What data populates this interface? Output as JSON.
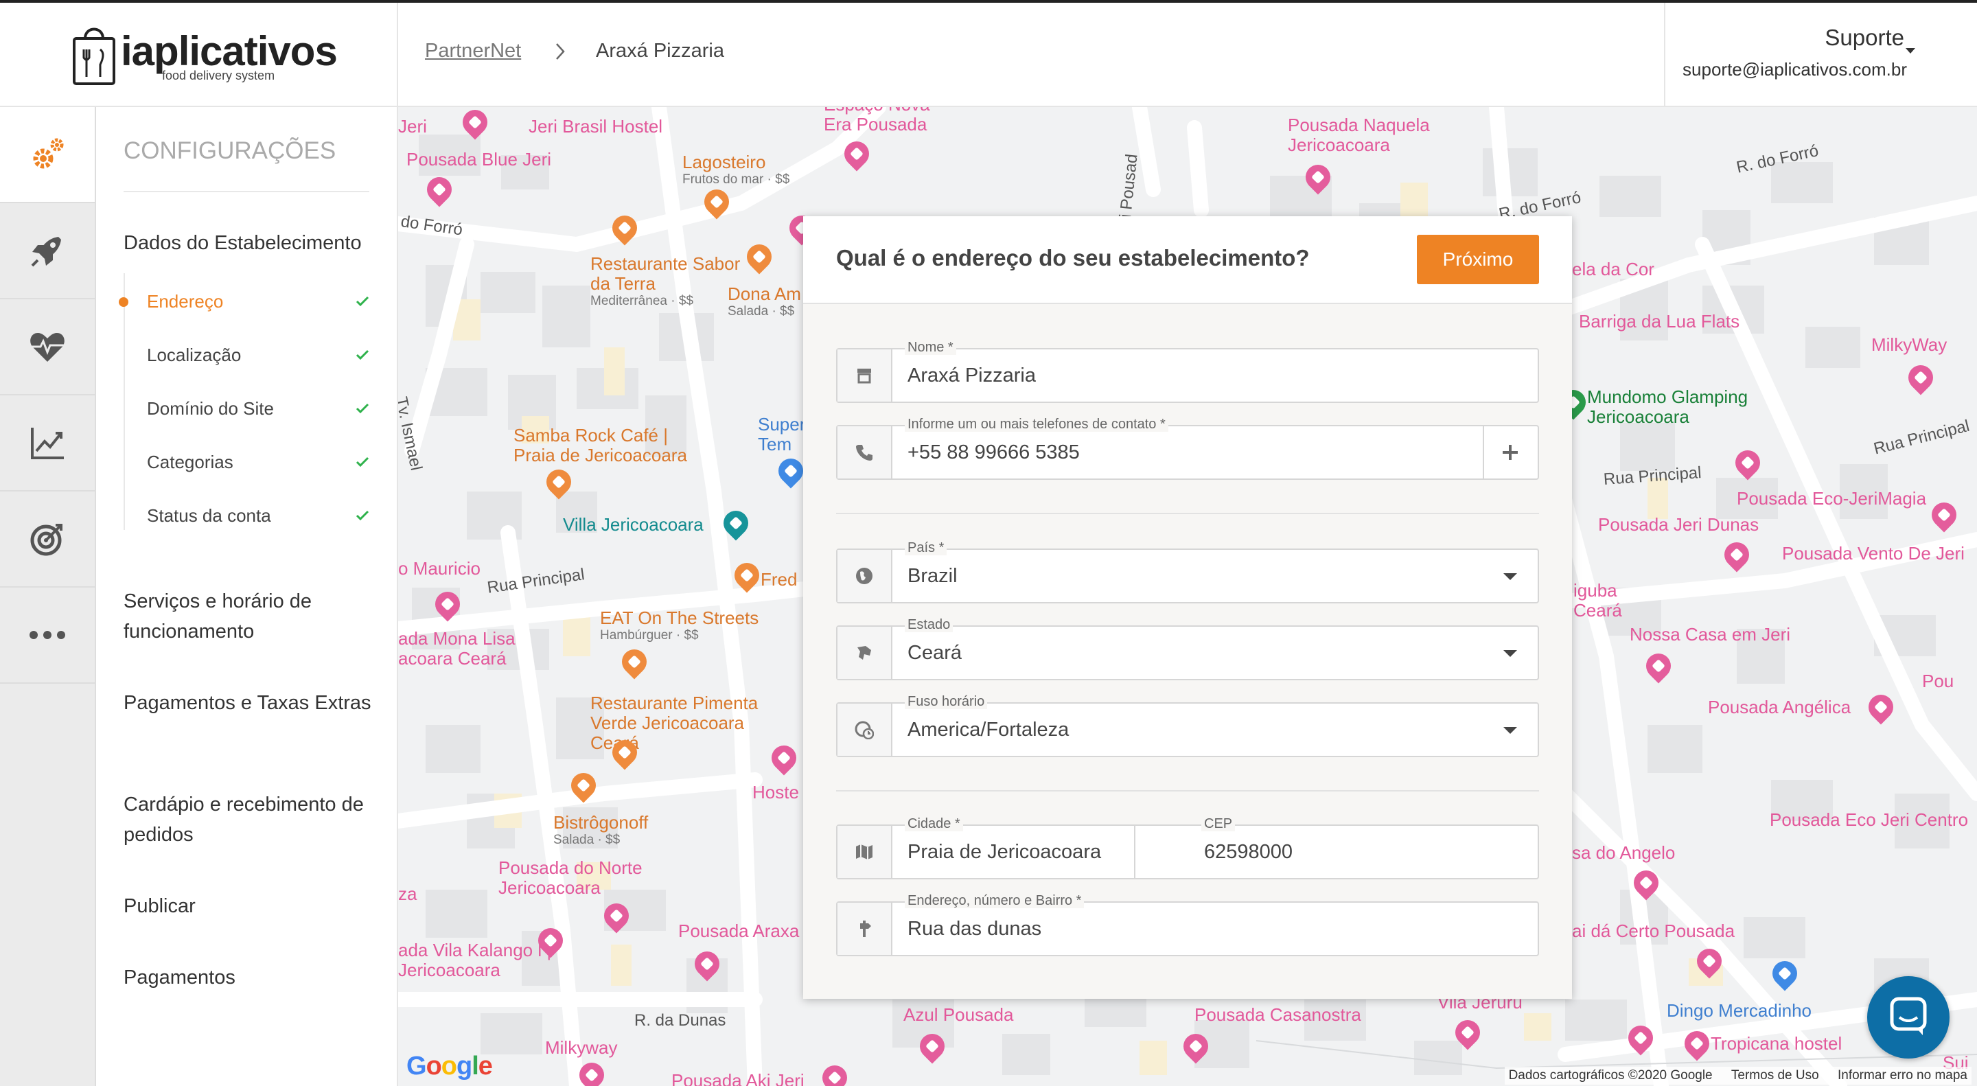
{
  "brand": {
    "name": "iaplicativos",
    "tagline": "food delivery system"
  },
  "breadcrumb": {
    "root": "PartnerNet",
    "current": "Araxá Pizzaria"
  },
  "user": {
    "name": "Suporte",
    "email": "suporte@iaplicativos.com.br"
  },
  "rail": {
    "icons": [
      "gears-icon",
      "rocket-icon",
      "heartbeat-icon",
      "line-chart-icon",
      "target-icon",
      "more-icon"
    ]
  },
  "sidebar": {
    "title": "CONFIGURAÇÕES",
    "section_establishment": "Dados do Estabelecimento",
    "sub_items": [
      {
        "label": "Endereço",
        "done": true,
        "active": true
      },
      {
        "label": "Localização",
        "done": true
      },
      {
        "label": "Domínio do Site",
        "done": true
      },
      {
        "label": "Categorias",
        "done": true
      },
      {
        "label": "Status da conta",
        "done": true
      }
    ],
    "sections": [
      "Serviços e horário de funcionamento",
      "Pagamentos e Taxas Extras",
      "Cardápio e recebimento de pedidos",
      "Publicar",
      "Pagamentos"
    ]
  },
  "dialog": {
    "title": "Qual é o endereço do seu estabelecimento?",
    "next_label": "Próximo",
    "fields": {
      "name": {
        "label": "Nome *",
        "value": "Araxá Pizzaria"
      },
      "phone": {
        "label": "Informe um ou mais telefones de contato *",
        "value": "+55 88 99666 5385"
      },
      "country": {
        "label": "País *",
        "value": "Brazil"
      },
      "state": {
        "label": "Estado",
        "value": "Ceará"
      },
      "timezone": {
        "label": "Fuso horário",
        "value": "America/Fortaleza"
      },
      "city": {
        "label": "Cidade *",
        "value": "Praia de Jericoacoara"
      },
      "zip": {
        "label": "CEP",
        "value": "62598000"
      },
      "address": {
        "label": "Endereço, número e Bairro *",
        "value": "Rua das dunas"
      }
    }
  },
  "map": {
    "labels": {
      "espaco": "Espaço Nova Era Pousada",
      "jeri": "Jeri",
      "jeri_brasil": "Jeri Brasil Hostel",
      "pousada_blue": "Pousada Blue Jeri",
      "lagosteiro": "Lagosteiro",
      "lagosteiro_sub": "Frutos do mar · $$",
      "do_forro": "do Forró",
      "sabor_terra": "Restaurante Sabor da Terra",
      "sabor_terra_sub": "Mediterrânea · $$",
      "dona_am": "Dona Am",
      "dona_am_sub": "Salada · $$",
      "jeri_pousad": "Jeri Pousad",
      "naquela": "Pousada Naquela Jericoacoara",
      "r_do_forro_1": "R. do Forró",
      "r_do_forro_2": "R. do Forró",
      "ela_da_cor": "ela da Cor",
      "barriga": "Barriga da Lua Flats",
      "milkyway_r": "MilkyWay",
      "mundomo": "Mundomo Glamping Jericoacoara",
      "rua_principal_r": "Rua Principal",
      "rua_principal_mid": "Rua Principal",
      "eco_jerimagia": "Pousada Eco-JeriMagia",
      "jeri_dunas": "Pousada Jeri Dunas",
      "vento": "Pousada Vento De Jeri",
      "tv_ismael": "Tv. Ismael",
      "samba": "Samba Rock Café | Praia de Jericoacoara",
      "super": "Super Tem",
      "villa": "Villa Jericoacoara",
      "mauricio": "o Mauricio",
      "rua_principal_l": "Rua Principal",
      "fred": "Fred",
      "eat": "EAT On The Streets",
      "eat_sub": "Hambúrguer · $$",
      "mona_lisa": "ada Mona Lisa acoara Ceará",
      "pimenta": "Restaurante Pimenta Verde Jericoacoara Ceará",
      "hoste": "Hoste",
      "bistrogonoff": "Bistrôgonoff",
      "bistrogonoff_sub": "Salada · $$",
      "do_norte": "Pousada do Norte Jericoacoara",
      "za": "za",
      "vila_kalango": "ada Vila Kalango l | Jericoacoara",
      "araxa": "Pousada Araxa",
      "r_da_dunas": "R. da Dunas",
      "azul": "Azul Pousada",
      "milkyway_b": "Milkyway",
      "aki_jeri": "Pousada Aki Jeri",
      "casanostra": "Pousada Casanostra",
      "vila_jeruru": "Vila Jeruru",
      "iguba": "iguba Ceará",
      "nossa_casa": "Nossa Casa em Jeri",
      "angelica": "Pousada Angélica",
      "pou": "Pou",
      "eco_jeri_centro": "Pousada Eco Jeri Centro",
      "do_angelo": "sa do Angelo",
      "certo": "ai dá Certo Pousada",
      "dingo": "Dingo Mercadinho",
      "tropicana": "Tropicana hostel",
      "sui": "Sui"
    },
    "google": "Google",
    "footer": [
      "Dados cartográficos ©2020 Google",
      "Termos de Uso",
      "Informar erro no mapa"
    ]
  },
  "colors": {
    "accent": "#ee8324",
    "check": "#2fb24c",
    "chat": "#0d6ea6"
  }
}
